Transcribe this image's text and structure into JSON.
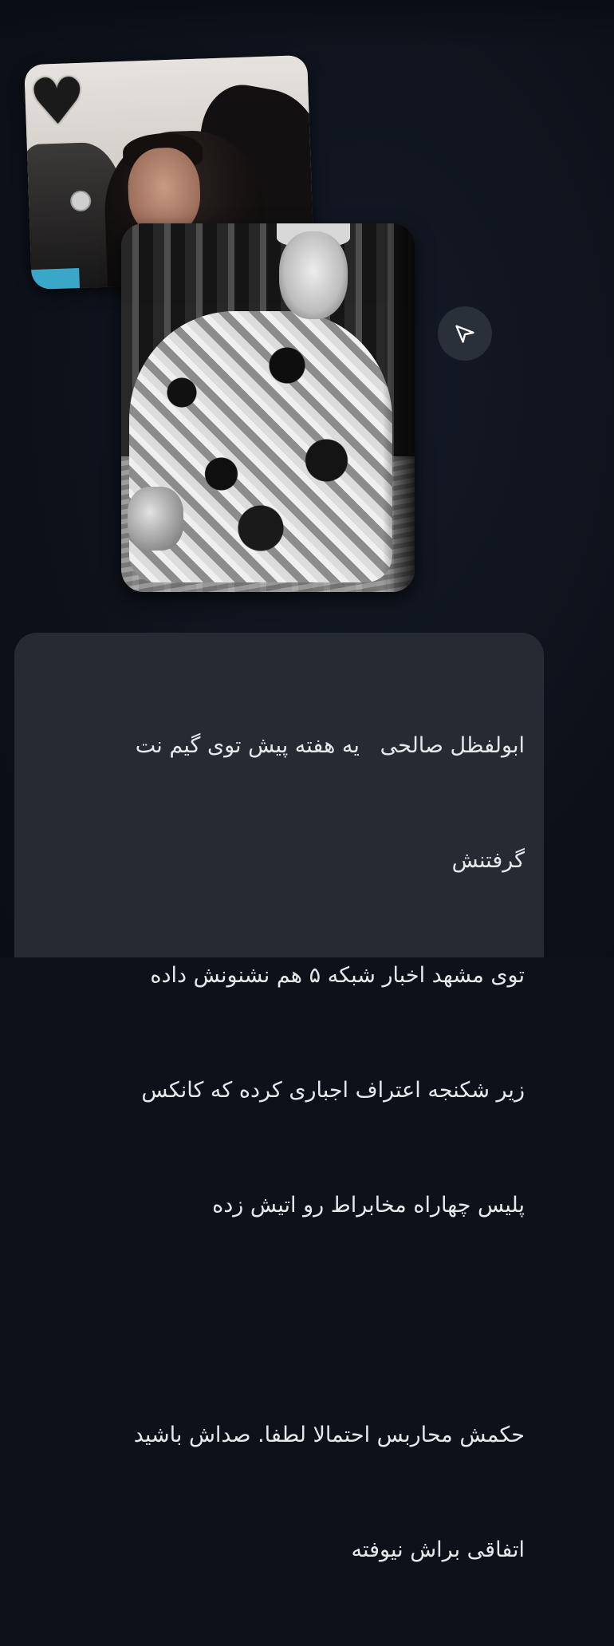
{
  "message": {
    "lines": [
      "ابولفظل صالحی   یه هفته پیش توی گیم نت",
      "گرفتنش",
      "توی مشهد اخبار شبکه ۵ هم نشنونش داده",
      "زیر شکنجه اعتراف اجباری کرده که کانکس",
      "پلیس چهاراه مخابراط رو اتیش زده",
      "",
      "حکمش محاربس احتمالا لطفا. صداش باشید",
      "اتفاقی براش نیوفته"
    ]
  },
  "icons": {
    "share": "share-arrow-icon",
    "heart_emoji": "black-heart-icon"
  },
  "colors": {
    "background": "#0d1119",
    "bubble": "#262a32",
    "share_button": "#2a303a",
    "text": "#e6e8ec"
  }
}
